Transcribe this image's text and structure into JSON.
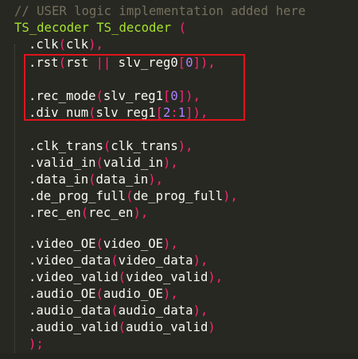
{
  "editor": {
    "comment": "// USER logic implementation added here",
    "module_type": "TS_decoder",
    "instance_name": "TS_decoder",
    "open_paren": "(",
    "ports": [
      {
        "name": ".clk",
        "arg": "clk",
        "sep": ","
      },
      {
        "name": ".rst",
        "arg": "rst || slv_reg0[0]",
        "sep": ","
      },
      {
        "name": ".rec_mode",
        "arg": "slv_reg1[0]",
        "sep": ","
      },
      {
        "name": ".div_num",
        "arg": "slv_reg1[2:1]",
        "sep": ","
      },
      {
        "name": ".clk_trans",
        "arg": "clk_trans",
        "sep": ","
      },
      {
        "name": ".valid_in",
        "arg": "valid_in",
        "sep": ","
      },
      {
        "name": ".data_in",
        "arg": "data_in",
        "sep": ","
      },
      {
        "name": ".de_prog_full",
        "arg": "de_prog_full",
        "sep": ","
      },
      {
        "name": ".rec_en",
        "arg": "rec_en",
        "sep": ","
      },
      {
        "name": ".video_OE",
        "arg": "video_OE",
        "sep": ","
      },
      {
        "name": ".video_data",
        "arg": "video_data",
        "sep": ","
      },
      {
        "name": ".video_valid",
        "arg": "video_valid",
        "sep": ","
      },
      {
        "name": ".audio_OE",
        "arg": "audio_OE",
        "sep": ","
      },
      {
        "name": ".audio_data",
        "arg": "audio_data",
        "sep": ","
      },
      {
        "name": ".audio_valid",
        "arg": "audio_valid",
        "sep": ""
      }
    ],
    "close": ");"
  },
  "colors": {
    "background": "#272822",
    "comment": "#75715e",
    "identifier": "#f8f8f2",
    "type": "#a6e22e",
    "keyword_punct": "#f92672",
    "number": "#ae81ff",
    "highlight_box": "#e0141b"
  }
}
